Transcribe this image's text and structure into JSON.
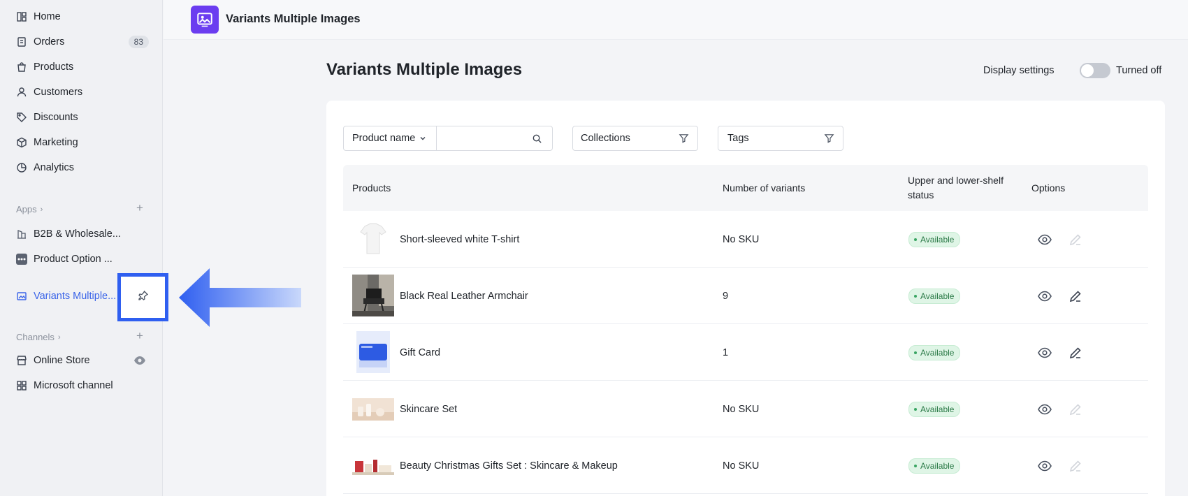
{
  "sidebar": {
    "items": [
      {
        "label": "Home",
        "icon": "home-icon"
      },
      {
        "label": "Orders",
        "icon": "orders-icon",
        "badge": "83"
      },
      {
        "label": "Products",
        "icon": "bag-icon"
      },
      {
        "label": "Customers",
        "icon": "person-icon"
      },
      {
        "label": "Discounts",
        "icon": "tag-icon"
      },
      {
        "label": "Marketing",
        "icon": "cube-icon"
      },
      {
        "label": "Analytics",
        "icon": "pie-chart-icon"
      }
    ],
    "apps_label": "Apps",
    "apps": [
      {
        "label": "B2B & Wholesale..."
      },
      {
        "label": "Product Option ..."
      },
      {
        "label": "Variants Multiple..."
      }
    ],
    "channels_label": "Channels",
    "channels": [
      {
        "label": "Online Store"
      },
      {
        "label": "Microsoft channel"
      }
    ]
  },
  "header": {
    "app_title": "Variants Multiple Images"
  },
  "main": {
    "title": "Variants Multiple Images",
    "display_settings": "Display settings",
    "toggle_label": "Turned off",
    "toggle_on": false
  },
  "filters": {
    "product_name": "Product name",
    "search_value": "",
    "collections": "Collections",
    "tags": "Tags"
  },
  "table": {
    "headers": [
      "Products",
      "Number of variants",
      "Upper and lower-shelf status",
      "Options"
    ],
    "rows": [
      {
        "product": "Short-sleeved white T-shirt",
        "variants": "No SKU",
        "status": "Available",
        "editable": false
      },
      {
        "product": "Black Real Leather Armchair",
        "variants": "9",
        "status": "Available",
        "editable": true
      },
      {
        "product": "Gift Card",
        "variants": "1",
        "status": "Available",
        "editable": true
      },
      {
        "product": "Skincare Set",
        "variants": "No SKU",
        "status": "Available",
        "editable": false
      },
      {
        "product": "Beauty Christmas Gifts Set : Skincare & Makeup",
        "variants": "No SKU",
        "status": "Available",
        "editable": false
      }
    ]
  },
  "colors": {
    "accent": "#3a64e8",
    "highlight": "#2f5ff0",
    "app_logo": "#6b3df0",
    "status_green": "#2b7a47"
  }
}
